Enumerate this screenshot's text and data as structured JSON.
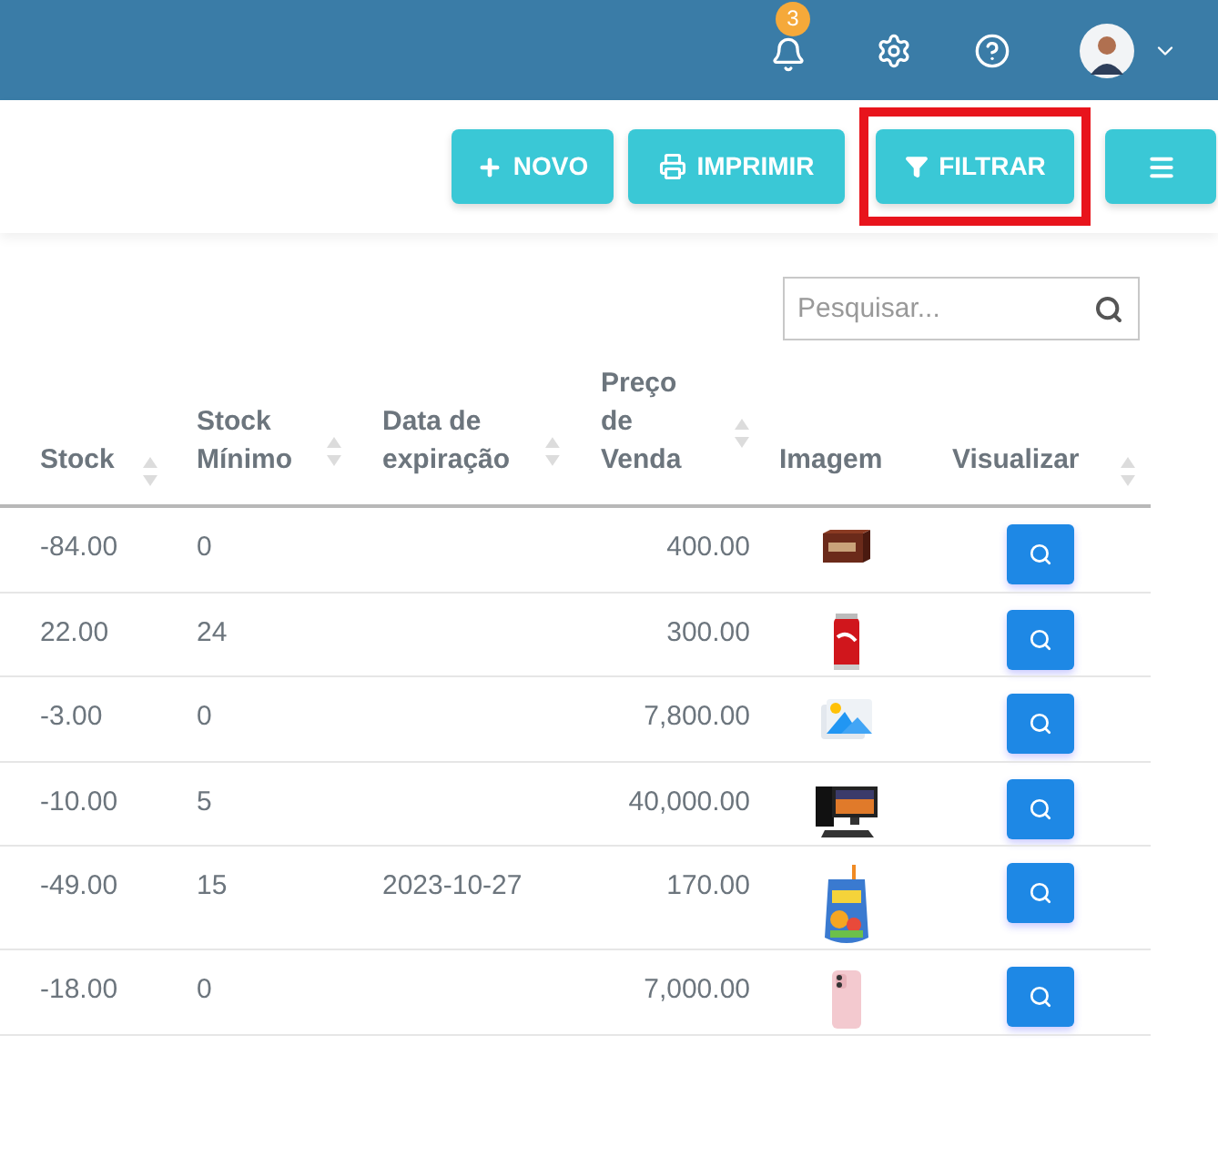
{
  "header": {
    "notification_count": "3"
  },
  "toolbar": {
    "buttons": [
      {
        "kind": "new",
        "label": "NOVO",
        "highlighted": false
      },
      {
        "kind": "print",
        "label": "IMPRIMIR",
        "highlighted": false
      },
      {
        "kind": "filter",
        "label": "FILTRAR",
        "highlighted": true
      },
      {
        "kind": "menu",
        "highlighted": false
      }
    ]
  },
  "search": {
    "placeholder": "Pesquisar..."
  },
  "table": {
    "columns": [
      {
        "label": "Stock",
        "sortable": true
      },
      {
        "label": "Stock Mínimo",
        "sortable": true
      },
      {
        "label": "Data de expiração",
        "sortable": true
      },
      {
        "label": "Preço de Venda",
        "sortable": true
      },
      {
        "label": "Imagem",
        "sortable": false
      },
      {
        "label": "Visualizar",
        "sortable": true
      }
    ],
    "rows": [
      {
        "stock": "-84.00",
        "min_stock": "0",
        "price": "400.00"
      },
      {
        "stock": "22.00",
        "min_stock": "24",
        "price": "300.00"
      },
      {
        "stock": "-3.00",
        "min_stock": "0",
        "price": "7,800.00"
      },
      {
        "stock": "-10.00",
        "min_stock": "5",
        "price": "40,000.00"
      },
      {
        "stock": "-49.00",
        "min_stock": "15",
        "expiry": "2023-10-27",
        "price": "170.00"
      },
      {
        "stock": "-18.00",
        "min_stock": "0",
        "price": "7,000.00"
      }
    ]
  }
}
